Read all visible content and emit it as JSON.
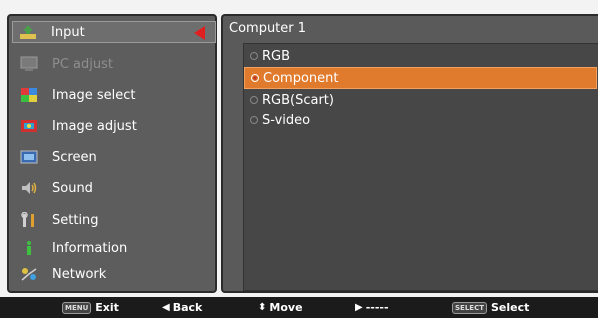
{
  "menu": {
    "items": [
      {
        "label": "Input",
        "icon": "input-icon",
        "selected": true
      },
      {
        "label": "PC adjust",
        "icon": "monitor-icon",
        "disabled": true
      },
      {
        "label": "Image select",
        "icon": "image-select-icon"
      },
      {
        "label": "Image adjust",
        "icon": "image-adjust-icon"
      },
      {
        "label": "Screen",
        "icon": "screen-icon"
      },
      {
        "label": "Sound",
        "icon": "speaker-icon"
      },
      {
        "label": "Setting",
        "icon": "tools-icon"
      },
      {
        "label": "Information",
        "icon": "info-icon"
      },
      {
        "label": "Network",
        "icon": "network-icon"
      }
    ]
  },
  "submenu": {
    "title": "Computer 1",
    "options": [
      {
        "label": "RGB"
      },
      {
        "label": "Component",
        "selected": true
      },
      {
        "label": "RGB(Scart)"
      },
      {
        "label": "S-video"
      }
    ]
  },
  "footer": {
    "exit": {
      "key": "MENU",
      "label": "Exit"
    },
    "back": {
      "glyph": "◀",
      "label": "Back"
    },
    "move": {
      "glyph": "⬍",
      "label": "Move"
    },
    "next": {
      "glyph": "▶",
      "label": "-----"
    },
    "select": {
      "key": "SELECT",
      "label": "Select"
    }
  },
  "colors": {
    "panel_bg": "#5d5d5d",
    "highlight": "#e07a2c",
    "arrow": "#e02020",
    "footer_bg": "#1b1b1b"
  }
}
